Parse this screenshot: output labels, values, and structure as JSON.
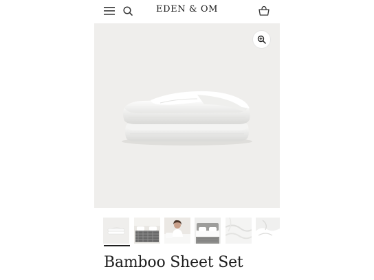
{
  "header": {
    "brand": "EDEN & OM",
    "icons": [
      "menu-icon",
      "search-icon",
      "cart-icon"
    ]
  },
  "hero": {
    "zoom_icon": "zoom-in-icon",
    "background": "#efeeec"
  },
  "gallery": {
    "thumbnails": [
      {
        "name": "folded-sheets",
        "active": true
      },
      {
        "name": "bed-grey-patterned",
        "active": false
      },
      {
        "name": "person-on-bed",
        "active": false
      },
      {
        "name": "bed-grey-headboard",
        "active": false
      },
      {
        "name": "white-sheet-closeup",
        "active": false
      },
      {
        "name": "white-sheet-detail",
        "active": false
      }
    ]
  },
  "product": {
    "title": "Bamboo Sheet Set"
  }
}
